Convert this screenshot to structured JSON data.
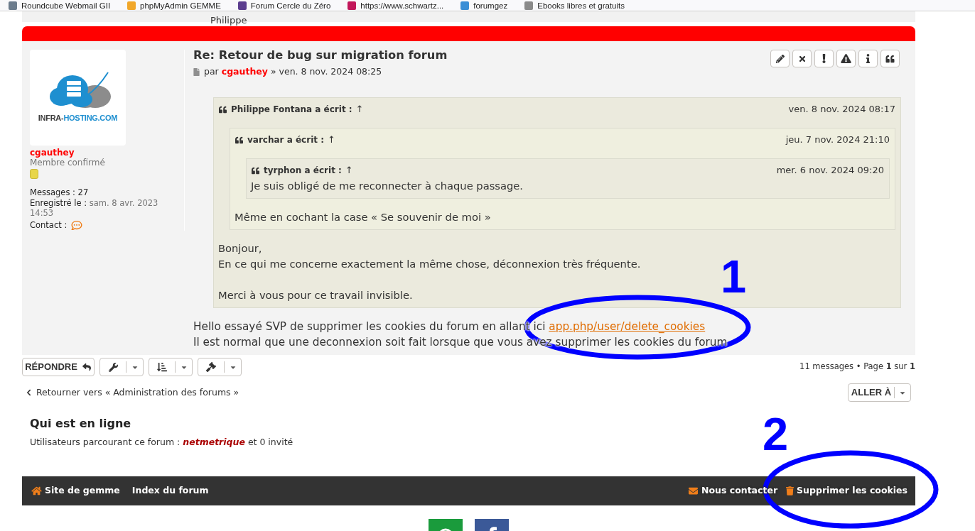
{
  "bookmarks": [
    {
      "label": "Roundcube Webmail GII"
    },
    {
      "label": "phpMyAdmin GEMME"
    },
    {
      "label": "Forum Cercle du Zéro"
    },
    {
      "label": "https://www.schwartz..."
    },
    {
      "label": "forumgez"
    },
    {
      "label": "Ebooks libres et gratuits"
    }
  ],
  "previous_post": {
    "text": "Philippe"
  },
  "post": {
    "author": {
      "logo_parts": [
        "INFRA-",
        "HOSTING.COM"
      ],
      "name": "cgauthey",
      "rank": "Membre confirmé",
      "messages_label": "Messages :",
      "messages": "27",
      "registered_label": "Enregistré le :",
      "registered": "sam. 8 avr. 2023 14:53",
      "contact_label": "Contact :"
    },
    "title": "Re: Retour de bug sur migration forum",
    "byline": {
      "prefix": "par",
      "author": "cgauthey",
      "separator": "»",
      "date": "ven. 8 nov. 2024 08:25"
    },
    "quote": {
      "cite": "Philippe Fontana a écrit :",
      "jump": "↑",
      "date": "ven. 8 nov. 2024 08:17",
      "quote": {
        "cite": "varchar a écrit :",
        "jump": "↑",
        "date": "jeu. 7 nov. 2024 21:10",
        "quote": {
          "cite": "tyrphon a écrit :",
          "jump": "↑",
          "date": "mer. 6 nov. 2024 09:20",
          "paragraphs": [
            [
              "Je suis obligé de me reconnecter à chaque passage."
            ]
          ]
        },
        "paragraphs": [
          [
            "Même en cochant la case « Se souvenir de moi »"
          ]
        ]
      },
      "paragraphs": [
        [
          "Bonjour,",
          "En ce qui me concerne exactement la même chose, déconnexion très fréquente."
        ],
        [
          "Merci à vous pour ce travail invisible."
        ]
      ]
    },
    "body": [
      {
        "text": "Hello essayé SVP de supprimer les cookies du forum en allant ici",
        "link": "app.php/user/delete_cookies"
      },
      {
        "text": "Il est normal que une deconnexion soit fait lorsque que vous avez supprimer les cookies du forum"
      }
    ]
  },
  "actions": {
    "reply": "RÉPONDRE",
    "pagination": "11 messages • Page **1** sur **1**"
  },
  "navigation": {
    "back": "Retourner vers « Administration des forums »",
    "jump": "ALLER À"
  },
  "online": {
    "title": "Qui est en ligne",
    "prefix": "Utilisateurs parcourant ce forum :",
    "users": [
      "netmetrique"
    ],
    "suffix": "et 0 invité"
  },
  "footer": {
    "left": [
      {
        "kind": "home",
        "label": "Site de gemme"
      },
      {
        "kind": "plain",
        "label": "Index du forum"
      }
    ],
    "right": [
      {
        "kind": "mail",
        "label": "Nous contacter"
      },
      {
        "kind": "trash",
        "label": "Supprimer les cookies"
      }
    ]
  },
  "annotations": [
    {
      "label": "1"
    },
    {
      "label": "2"
    }
  ]
}
